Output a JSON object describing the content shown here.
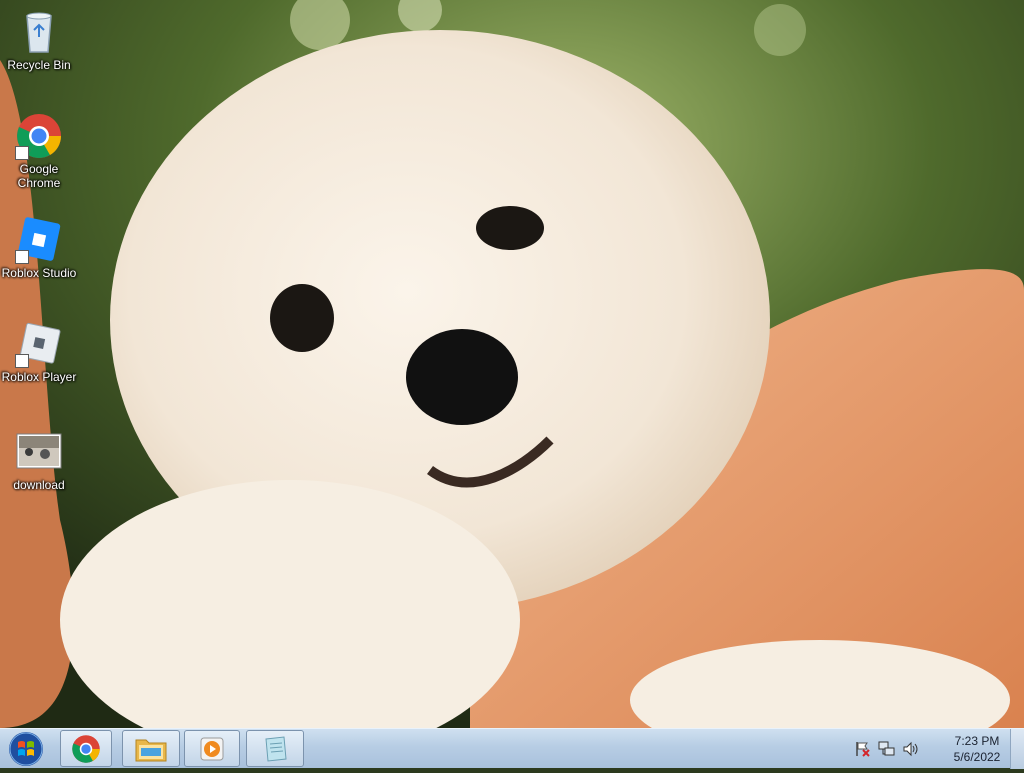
{
  "desktop": {
    "icons": [
      {
        "label": "Recycle Bin",
        "icon": "recycle-bin-icon"
      },
      {
        "label": "Google Chrome",
        "icon": "chrome-icon"
      },
      {
        "label": "Roblox Studio",
        "icon": "roblox-studio-icon"
      },
      {
        "label": "Roblox Player",
        "icon": "roblox-player-icon"
      },
      {
        "label": "download",
        "icon": "image-file-icon"
      }
    ]
  },
  "taskbar": {
    "start": {
      "icon": "windows-start-icon"
    },
    "pinned": [
      {
        "icon": "chrome-icon"
      },
      {
        "icon": "file-explorer-icon"
      },
      {
        "icon": "media-player-icon"
      },
      {
        "icon": "notepad-icon"
      }
    ],
    "tray": {
      "icons": [
        "action-center-icon",
        "network-icon",
        "volume-icon"
      ],
      "time": "7:23 PM",
      "date": "5/6/2022"
    }
  },
  "colors": {
    "taskbar": "#b7cde4",
    "icon_label": "#ffffff",
    "clock_text": "#1a2230"
  }
}
